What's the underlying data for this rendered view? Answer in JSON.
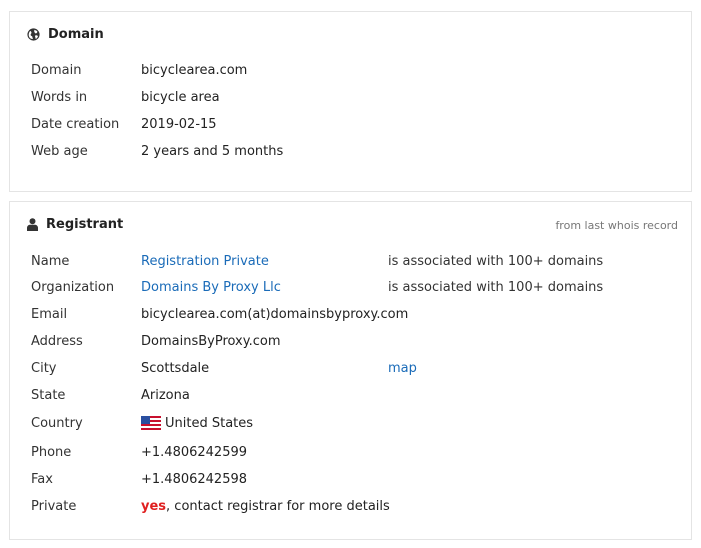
{
  "domain_panel": {
    "title": "Domain",
    "icon": "globe-icon",
    "rows": [
      {
        "label": "Domain",
        "value": "bicyclearea.com"
      },
      {
        "label": "Words in",
        "value": "bicycle area"
      },
      {
        "label": "Date creation",
        "value": "2019-02-15"
      },
      {
        "label": "Web age",
        "value": "2 years and 5 months"
      }
    ]
  },
  "registrant_panel": {
    "title": "Registrant",
    "icon": "user-icon",
    "note": "from last whois record",
    "name": {
      "label": "Name",
      "value": "Registration Private",
      "extra": "is associated with 100+ domains"
    },
    "organization": {
      "label": "Organization",
      "value": "Domains By Proxy Llc",
      "extra": "is associated with 100+ domains"
    },
    "email": {
      "label": "Email",
      "value": "bicyclearea.com(at)domainsbyproxy.com"
    },
    "address": {
      "label": "Address",
      "value": "DomainsByProxy.com"
    },
    "city": {
      "label": "City",
      "value": "Scottsdale",
      "extra": "map"
    },
    "state": {
      "label": "State",
      "value": "Arizona"
    },
    "country": {
      "label": "Country",
      "value": "United States",
      "flag": "us-flag-icon"
    },
    "phone": {
      "label": "Phone",
      "value": "+1.4806242599"
    },
    "fax": {
      "label": "Fax",
      "value": "+1.4806242598"
    },
    "private": {
      "label": "Private",
      "value_flag": "yes",
      "value_rest": ", contact registrar for more details"
    }
  },
  "colors": {
    "link": "#1a6bb8",
    "yes": "#e02020",
    "border": "#e4e4e4"
  }
}
